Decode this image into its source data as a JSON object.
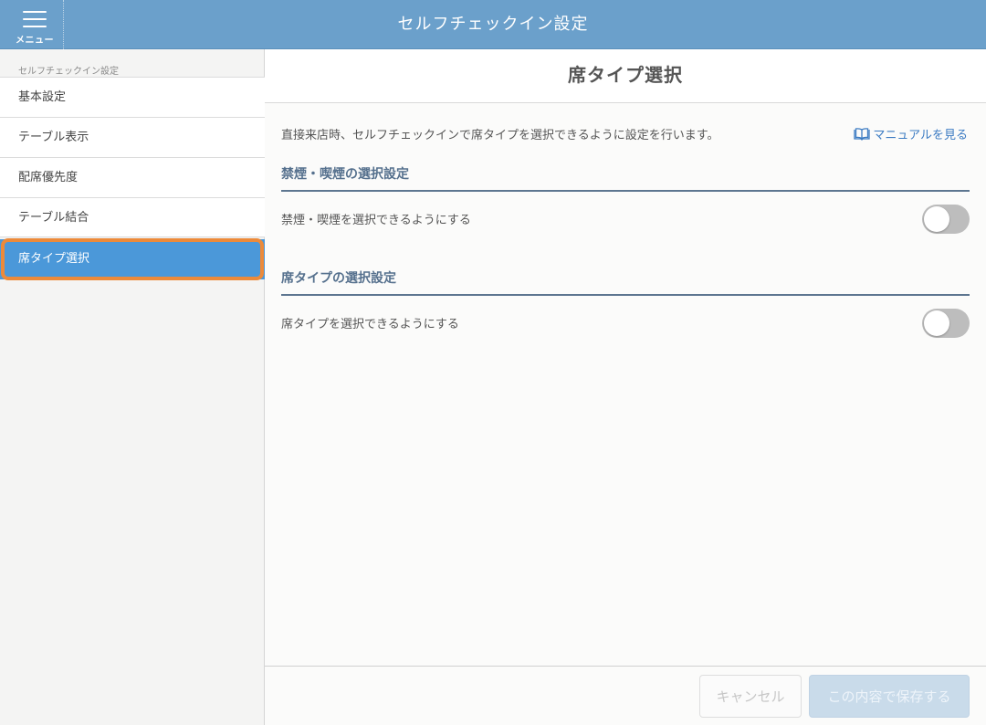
{
  "header": {
    "menu_label": "メニュー",
    "title": "セルフチェックイン設定"
  },
  "sidebar": {
    "heading": "セルフチェックイン設定",
    "items": [
      {
        "label": "基本設定"
      },
      {
        "label": "テーブル表示"
      },
      {
        "label": "配席優先度"
      },
      {
        "label": "テーブル結合"
      },
      {
        "label": "席タイプ選択",
        "active": true
      }
    ]
  },
  "main": {
    "title": "席タイプ選択",
    "description": "直接来店時、セルフチェックインで席タイプを選択できるように設定を行います。",
    "manual_link": "マニュアルを見る",
    "sections": [
      {
        "title": "禁煙・喫煙の選択設定",
        "row_label": "禁煙・喫煙を選択できるようにする",
        "enabled": false
      },
      {
        "title": "席タイプの選択設定",
        "row_label": "席タイプを選択できるようにする",
        "enabled": false
      }
    ]
  },
  "footer": {
    "cancel_label": "キャンセル",
    "save_label": "この内容で保存する"
  },
  "colors": {
    "header_bg": "#6ba0cb",
    "active_item_bg": "#4b98d9",
    "active_item_outline": "#ec8a3a",
    "section_title": "#55708d",
    "link": "#3d7cc3"
  }
}
